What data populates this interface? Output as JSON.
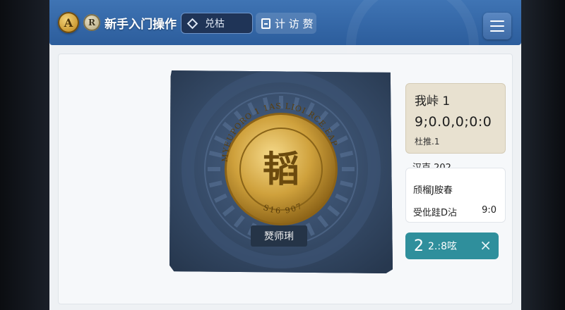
{
  "header": {
    "badge_a": "A",
    "badge_r": "R",
    "title": "新手入门操作",
    "search_label": "兑枯",
    "visit_label": "计 访 赘",
    "menu_icon": "hamburger-menu-icon"
  },
  "coin": {
    "center_char": "韬",
    "ring_top": "MYEUPORO 1 1AS LIOI RCE.EAP",
    "ring_bottom": "S16 907",
    "label": "燹师琍"
  },
  "panel": {
    "title": "我峠 1",
    "value": "9;0.0,0;0:0",
    "sub": "杜推.1"
  },
  "section_label": "汉克 202",
  "info": {
    "row1": "颀榴J胺春",
    "row2": "受仳跬D沾",
    "time": "9:0"
  },
  "timer": {
    "number": "2",
    "text": "2.:8呟",
    "close": "×"
  },
  "colors": {
    "header": "#3a6aa8",
    "card": "#2f4565",
    "coin_gold": "#c9a13a",
    "timer": "#2f8f9c",
    "panel": "#e8e1d0"
  }
}
